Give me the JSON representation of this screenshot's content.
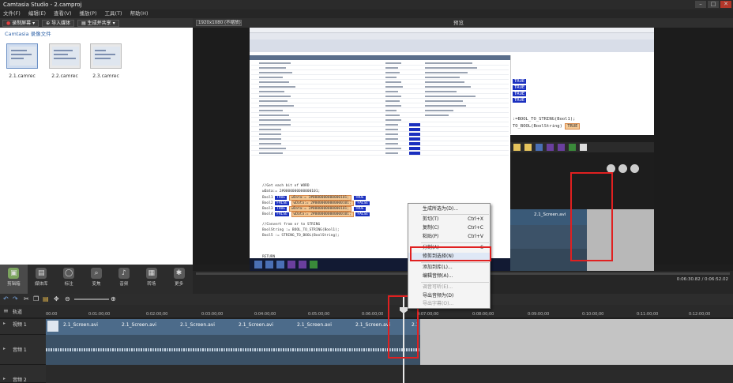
{
  "window": {
    "title": "Camtasia Studio - 2.camproj"
  },
  "menubar": [
    "文件(F)",
    "编辑(E)",
    "查看(V)",
    "播放(P)",
    "工具(T)",
    "帮助(H)"
  ],
  "toolbar": {
    "record": "录制屏幕",
    "import": "导入媒体",
    "produce": "生成并共享"
  },
  "clipbin": {
    "title": "Camtasia 录像文件",
    "clips": [
      "2.1.camrec",
      "2.2.camrec",
      "2.3.camrec"
    ]
  },
  "tasks": [
    "剪辑箱",
    "媒体库",
    "标注",
    "变焦",
    "音频",
    "转场",
    "更多"
  ],
  "preview": {
    "size": "1920x1080 (不缩放)",
    "title": "预览",
    "timecode": "0:06:30.82 / 0:06:52.02"
  },
  "embedded": {
    "code_comment1": "//Get each bit of WORD",
    "code_wdata": "wData:= 2#0000000000000101;",
    "bool_lines": [
      "Bool1",
      "Bool2",
      "Bool3",
      "Bool4"
    ],
    "true_lbl": "TRUE",
    "false_lbl": "FALSE",
    "code_comment2": "//Convert from or to STRING",
    "code_bts": "BoolString := BOOL_TO_STRING(Bool1);",
    "code_stb": "Bool5 := STRING_TO_BOOL(BoolString);",
    "rp_line1": ":=BOOL_TO_STRING(Bool1);",
    "rp_line2": "TO_BOOL(BoolString)",
    "nested_clip": "2.1_Screen.avi",
    "nested_time": "0:07:00:00",
    "return_lbl": "RETURN"
  },
  "context_menu": [
    {
      "label": "生成所选为(D)...",
      "shortcut": "",
      "disabled": false
    },
    {
      "label": "剪切(T)",
      "shortcut": "Ctrl+X",
      "disabled": false
    },
    {
      "label": "复制(C)",
      "shortcut": "Ctrl+C",
      "disabled": false
    },
    {
      "label": "粘贴(P)",
      "shortcut": "Ctrl+V",
      "disabled": false
    },
    {
      "label": "分割(A)",
      "shortcut": "S",
      "disabled": false
    },
    {
      "label": "修剪到选择(N)",
      "shortcut": "",
      "disabled": false
    },
    {
      "label": "添加到库(L)...",
      "shortcut": "",
      "disabled": false
    },
    {
      "label": "编辑音频(A)...",
      "shortcut": "",
      "disabled": false
    },
    {
      "label": "调音可听(E)...",
      "shortcut": "",
      "disabled": true
    },
    {
      "label": "导出音频为(D)",
      "shortcut": "",
      "disabled": false
    },
    {
      "label": "导出字幕(O)...",
      "shortcut": "",
      "disabled": true
    }
  ],
  "timeline": {
    "tracks_label": "轨道",
    "ruler": [
      "00:00",
      "0:01:00;00",
      "0:02:00;00",
      "0:03:00;00",
      "0:04:00;00",
      "0:05:00;00",
      "0:06:00;00",
      "0:07:00;00",
      "0:08:00;00",
      "0:09:00;00",
      "0:10:00;00",
      "0:11:00;00",
      "0:12:00;00"
    ],
    "video_track": "视频 1",
    "audio_track1": "音频 1",
    "audio_track2": "音频 2",
    "video_clips": [
      "2.1_Screen.avi",
      "2.1_Screen.avi",
      "2.1_Screen.avi",
      "2.1_Screen.avi",
      "2.1_Screen.avi",
      "2.1_Screen.avi"
    ],
    "split_label": "2.1"
  }
}
